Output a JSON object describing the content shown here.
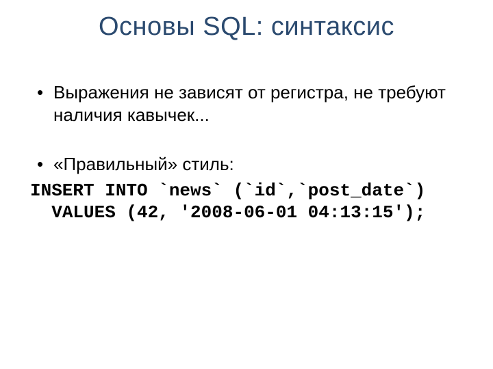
{
  "title": "Основы SQL: синтаксис",
  "bullets": {
    "items": [
      "Выражения не зависят от регистра, не требуют наличия кавычек...",
      "«Правильный» стиль:"
    ]
  },
  "code": "INSERT INTO `news` (`id`,`post_date`)\n  VALUES (42, '2008-06-01 04:13:15');"
}
